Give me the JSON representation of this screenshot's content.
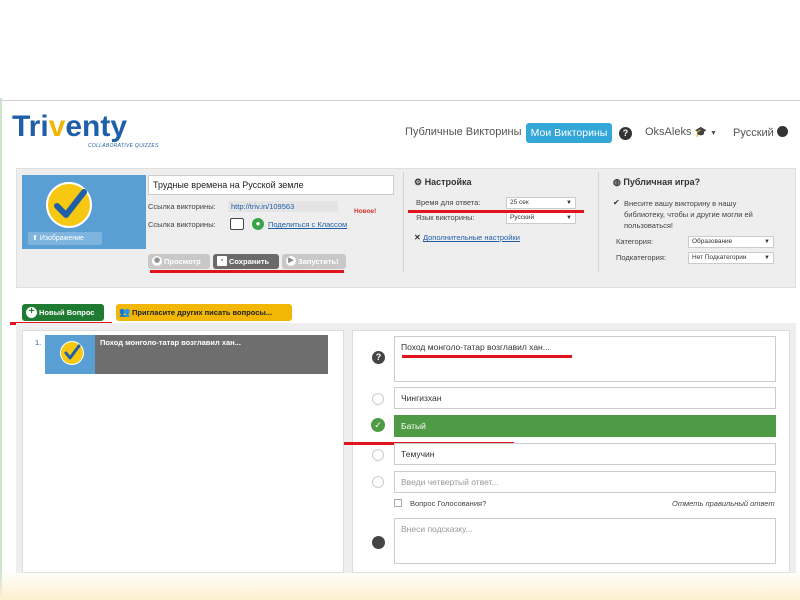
{
  "brand": {
    "logo_main_a": "Tri",
    "logo_main_v": "v",
    "logo_main_b": "enty",
    "logo_sub": "COLLABORATIVE QUIZZES",
    "primary_color": "#1f5fa8",
    "accent_color": "#f2b705"
  },
  "nav": {
    "public_quizzes": "Публичные Викторины",
    "my_quizzes": "Мои Викторины",
    "help": "?",
    "user": "OksAleks",
    "language": "Русский"
  },
  "quiz": {
    "title": "Трудные времена на Русской земле",
    "image_button": "Изображение",
    "link_label_1": "Ссылка викторины:",
    "link_value": "http://triv.in/109563",
    "link_label_2": "Ссылка викторины:",
    "share_link": "Поделиться с Классом",
    "new_badge": "Новое!",
    "btn_preview": "Просмотр",
    "btn_save": "Сохранить",
    "btn_start": "Запустить!"
  },
  "settings": {
    "title": "Настройка",
    "answer_time_label": "Время для ответа:",
    "answer_time_value": "25 сек",
    "language_label": "Язык викторины:",
    "language_value": "Русский",
    "advanced_link": "Дополнительные настройки"
  },
  "public_game": {
    "title": "Публичная игра?",
    "checkbox_text": "Внесите вашу викторину в нашу библиотеку, чтобы и другие могли ей пользоваться!",
    "category_label": "Категория:",
    "category_value": "Образование",
    "subcategory_label": "Подкатегория:",
    "subcategory_value": "Нет Подкатегории"
  },
  "toolbar": {
    "new_question": "Новый Вопрос",
    "invite": "Пригласите других писать вопросы..."
  },
  "question_list": [
    {
      "number": "1.",
      "text": "Поход монголо-татар возглавил хан..."
    }
  ],
  "editor": {
    "question_text": "Поход монголо-татар возглавил хан...",
    "answers": [
      {
        "text": "Чингизхан",
        "correct": false,
        "placeholder": false
      },
      {
        "text": "Батый",
        "correct": true,
        "placeholder": false
      },
      {
        "text": "Темучин",
        "correct": false,
        "placeholder": false
      },
      {
        "text": "Введи четвертый ответ...",
        "correct": false,
        "placeholder": true
      }
    ],
    "poll_label": "Вопрос Голосования?",
    "mark_correct": "Отметь правильный ответ",
    "hint_placeholder": "Внеси подсказку..."
  }
}
